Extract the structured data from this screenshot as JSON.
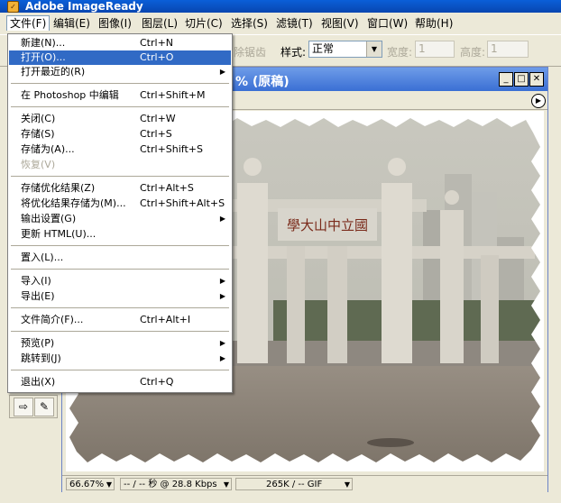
{
  "app": {
    "title": "Adobe ImageReady"
  },
  "menubar": [
    "文件(F)",
    "编辑(E)",
    "图像(I)",
    "图层(L)",
    "切片(C)",
    "选择(S)",
    "滤镜(T)",
    "视图(V)",
    "窗口(W)",
    "帮助(H)"
  ],
  "options": {
    "antialias_label": "除锯齿",
    "style_label": "样式:",
    "style_value": "正常",
    "width_label": "宽度:",
    "width_value": "1",
    "height_label": "高度:",
    "height_value": "1"
  },
  "file_menu": [
    {
      "label": "新建(N)...",
      "shortcut": "Ctrl+N"
    },
    {
      "label": "打开(O)...",
      "shortcut": "Ctrl+O"
    },
    {
      "label": "打开最近的(R)",
      "shortcut": ""
    },
    {
      "label": "在 Photoshop 中编辑",
      "shortcut": "Ctrl+Shift+M"
    },
    {
      "label": "关闭(C)",
      "shortcut": "Ctrl+W"
    },
    {
      "label": "存储(S)",
      "shortcut": "Ctrl+S"
    },
    {
      "label": "存储为(A)...",
      "shortcut": "Ctrl+Shift+S"
    },
    {
      "label": "恢复(V)",
      "shortcut": ""
    },
    {
      "label": "存储优化结果(Z)",
      "shortcut": "Ctrl+Alt+S"
    },
    {
      "label": "将优化结果存储为(M)...",
      "shortcut": "Ctrl+Shift+Alt+S"
    },
    {
      "label": "输出设置(G)",
      "shortcut": ""
    },
    {
      "label": "更新 HTML(U)...",
      "shortcut": ""
    },
    {
      "label": "置入(L)...",
      "shortcut": ""
    },
    {
      "label": "导入(I)",
      "shortcut": ""
    },
    {
      "label": "导出(E)",
      "shortcut": ""
    },
    {
      "label": "文件简介(F)...",
      "shortcut": "Ctrl+Alt+I"
    },
    {
      "label": "预览(P)",
      "shortcut": ""
    },
    {
      "label": "跳转到(J)",
      "shortcut": ""
    },
    {
      "label": "退出(X)",
      "shortcut": "Ctrl+Q"
    }
  ],
  "document": {
    "title": "% (原稿)",
    "gate_inscription": "學大山中立國"
  },
  "status": {
    "zoom": "66.67%",
    "download": "-- / -- 秒 @ 28.8 Kbps",
    "size": "265K / -- GIF"
  },
  "icons": {
    "app": "imageready-app-icon",
    "minimize": "minimize-icon",
    "maximize": "maximize-icon",
    "close": "close-icon",
    "submenu": "submenu-arrow-icon",
    "dropdown": "chevron-down-icon"
  },
  "colors": {
    "title_bar": "#0a5fd8",
    "menu_highlight": "#316ac5",
    "doc_title": "#3a6fd4"
  }
}
